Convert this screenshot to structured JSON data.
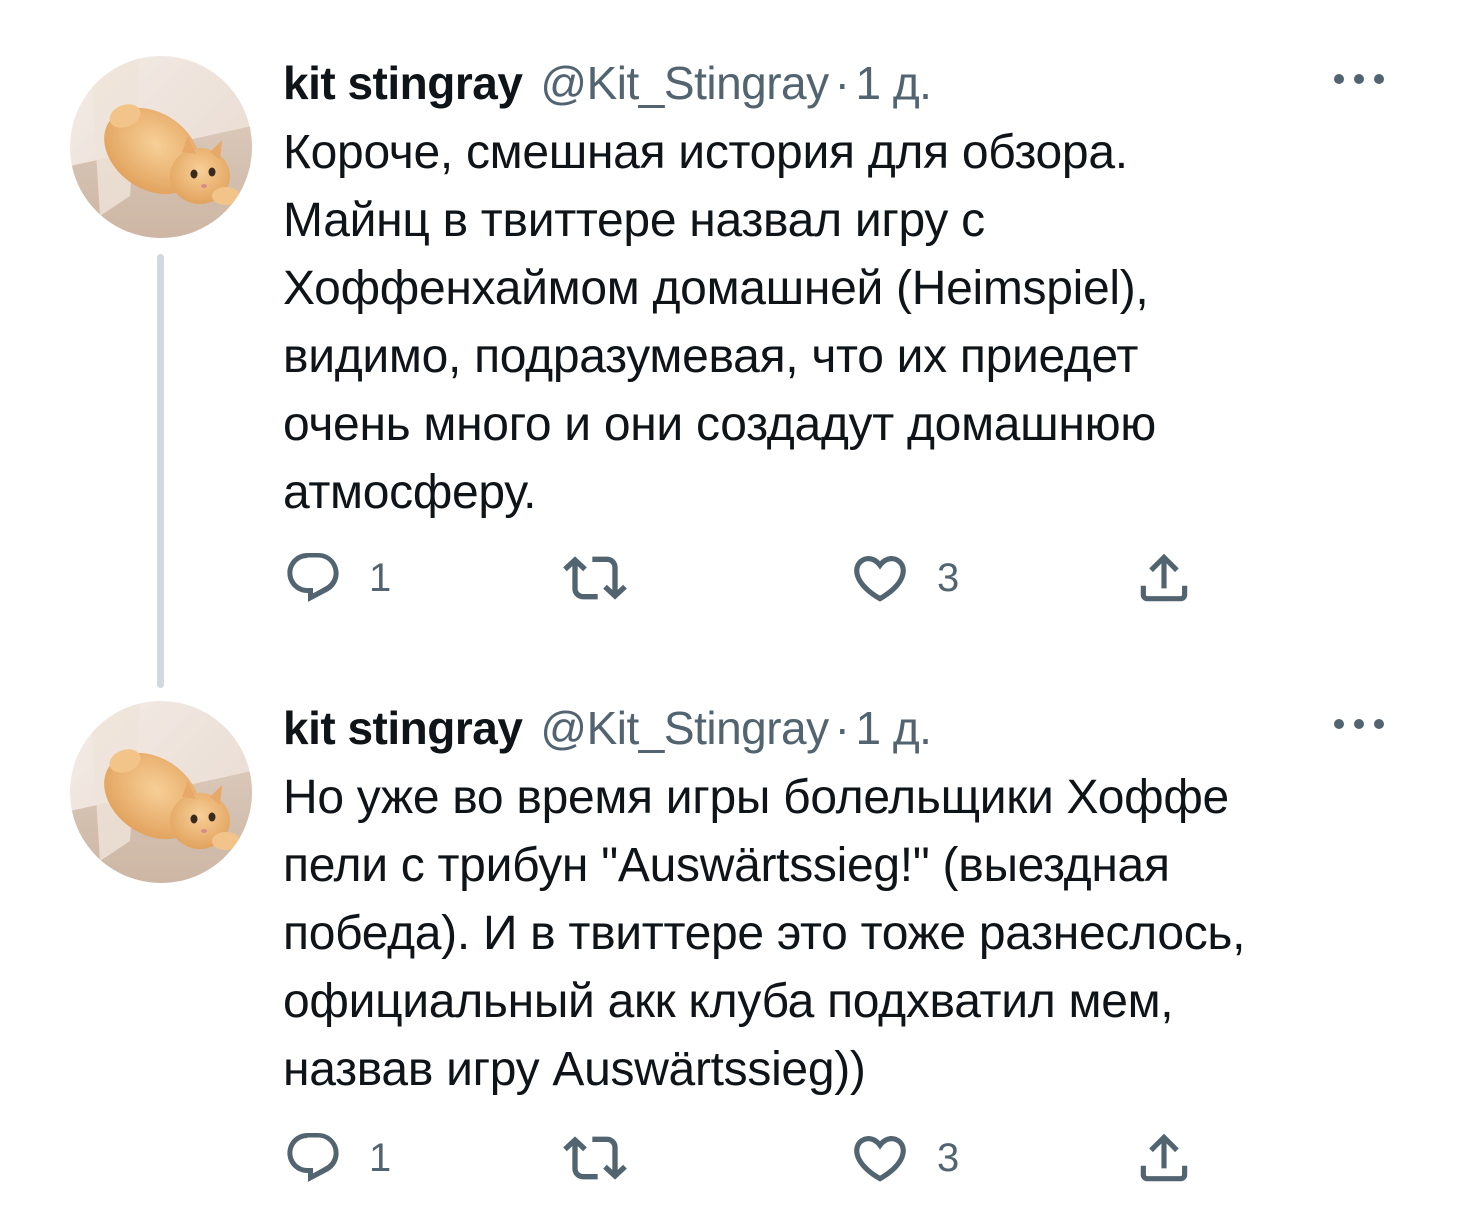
{
  "tweets": [
    {
      "display_name": "kit stingray",
      "handle": "@Kit_Stingray",
      "separator": "·",
      "time": "1 д.",
      "lines": [
        "Короче, смешная история для обзора.",
        "Майнц в твиттере назвал игру с",
        "Хоффенхаймом домашней (Heimspiel),",
        "видимо, подразумевая, что их приедет",
        "очень много и они создадут домашнюю",
        "атмосферу."
      ],
      "actions": {
        "reply_icon": "reply-icon",
        "reply_count": "1",
        "retweet_icon": "retweet-icon",
        "retweet_count": "",
        "like_icon": "heart-icon",
        "like_count": "3",
        "share_icon": "share-icon"
      }
    },
    {
      "display_name": "kit stingray",
      "handle": "@Kit_Stingray",
      "separator": "·",
      "time": "1 д.",
      "lines": [
        "Но уже во время игры болельщики Хоффе",
        "пели с трибун \"Auswärtssieg!\" (выездная",
        "победа). И в твиттере это тоже разнеслось,",
        "официальный акк клуба подхватил мем,",
        "назвав игру Auswärtssieg))"
      ],
      "actions": {
        "reply_icon": "reply-icon",
        "reply_count": "1",
        "retweet_icon": "retweet-icon",
        "retweet_count": "",
        "like_icon": "heart-icon",
        "like_count": "3",
        "share_icon": "share-icon"
      }
    }
  ],
  "colors": {
    "text_primary": "#0f1419",
    "text_secondary": "#536471",
    "thread_line": "#cfd9de",
    "background": "#ffffff"
  },
  "avatar": {
    "description_icon": "cat-photo-avatar"
  }
}
